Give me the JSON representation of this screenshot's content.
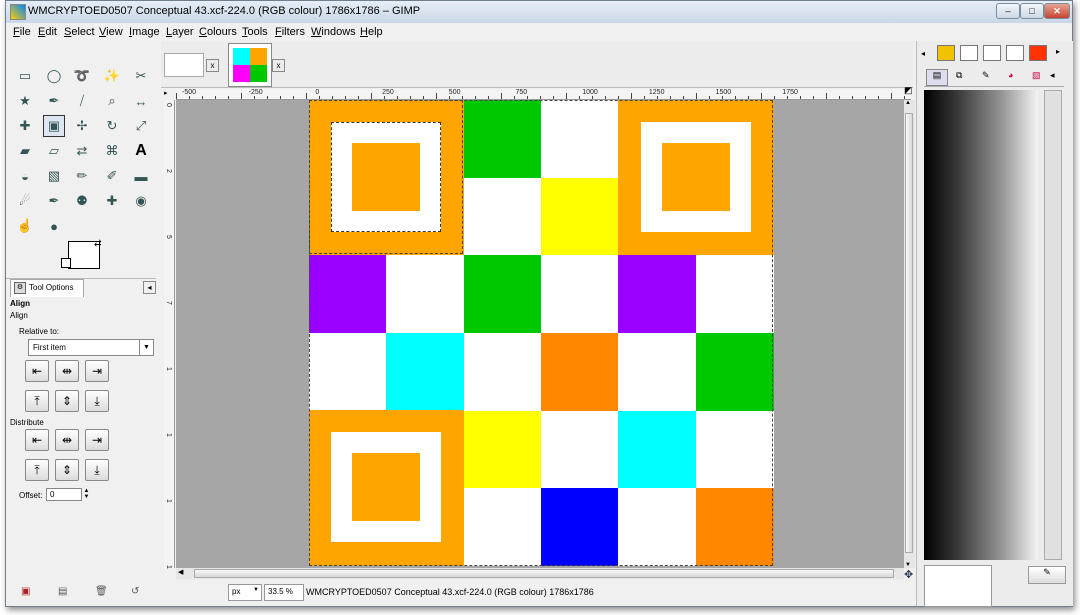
{
  "window": {
    "title": "WMCRYPTOED0507 Conceptual 43.xcf-224.0 (RGB colour) 1786x1786 – GIMP",
    "minimize": "–",
    "maximize": "□",
    "close": "✕"
  },
  "menu": [
    "File",
    "Edit",
    "Select",
    "View",
    "Image",
    "Layer",
    "Colours",
    "Tools",
    "Filters",
    "Windows",
    "Help"
  ],
  "toolbox": {
    "tools": [
      "rect-select-icon",
      "ellipse-select-icon",
      "lasso-icon",
      "fuzzy-select-icon",
      "scissors-icon",
      "select-by-colour-icon",
      "paths-icon",
      "colour-picker-icon",
      "zoom-icon",
      "measure-icon",
      "move-icon",
      "align-icon",
      "crop-icon",
      "rotate-icon",
      "scale-icon",
      "shear-icon",
      "perspective-icon",
      "flip-icon",
      "cage-transform-icon",
      "text-icon",
      "bucket-fill-icon",
      "blend-icon",
      "pencil-icon",
      "paintbrush-icon",
      "eraser-icon",
      "airbrush-icon",
      "ink-icon",
      "clone-icon",
      "heal-icon",
      "blur-icon",
      "smudge-icon",
      "dodge-burn-icon"
    ],
    "glyphs": [
      "▭",
      "◯",
      "➰",
      "✨",
      "✂",
      "★",
      "✒",
      "⧸",
      "⌕",
      "↔",
      "✚",
      "▣",
      "✢",
      "↻",
      "⤢",
      "▰",
      "▱",
      "⇄",
      "⌘",
      "A",
      "◒",
      "▧",
      "✏",
      "✐",
      "▬",
      "☄",
      "✒",
      "⚉",
      "✚",
      "◉",
      "☝",
      "●"
    ]
  },
  "tool_options": {
    "tab_label": "Tool Options",
    "heading": "Align",
    "subheading": "Align",
    "relative_to_label": "Relative to:",
    "relative_to_value": "First item",
    "distribute_label": "Distribute",
    "offset_label": "Offset:",
    "offset_value": "0"
  },
  "rulers": {
    "horizontal": [
      "-500",
      "-250",
      "0",
      "250",
      "500",
      "750",
      "1000",
      "1250",
      "1500",
      "1750"
    ],
    "vertical": [
      "0",
      "2",
      "5",
      "7",
      "1",
      "1",
      "1",
      "1"
    ]
  },
  "image": {
    "grid": [
      [
        "#ffa500",
        "#ffa500",
        "#00c800",
        "#ffffff",
        "#ffa500",
        "#ffa500"
      ],
      [
        "#ffa500",
        "#ffa500",
        "#ffffff",
        "#ffff00",
        "#ffa500",
        "#ffa500"
      ],
      [
        "#9900ff",
        "#ffffff",
        "#00c800",
        "#ffffff",
        "#9900ff",
        "#ffffff"
      ],
      [
        "#ffffff",
        "#00ffff",
        "#ffffff",
        "#ff8800",
        "#ffffff",
        "#00c800"
      ],
      [
        "#ffa500",
        "#ffa500",
        "#ffff00",
        "#ffffff",
        "#00ffff",
        "#ffffff"
      ],
      [
        "#ffa500",
        "#ffa500",
        "#ffffff",
        "#0000ff",
        "#ffffff",
        "#ff8800"
      ]
    ],
    "finder_color": "#ffa500"
  },
  "statusbar": {
    "unit": "px",
    "zoom": "33.5 %",
    "text": "WMCRYPTOED0507 Conceptual 43.xcf-224.0 (RGB colour) 1786x1786"
  },
  "colors": {
    "palette_tabs": [
      "#f2c200",
      "#ffffff",
      "#ffffff",
      "#ffffff",
      "#ff3300"
    ]
  }
}
